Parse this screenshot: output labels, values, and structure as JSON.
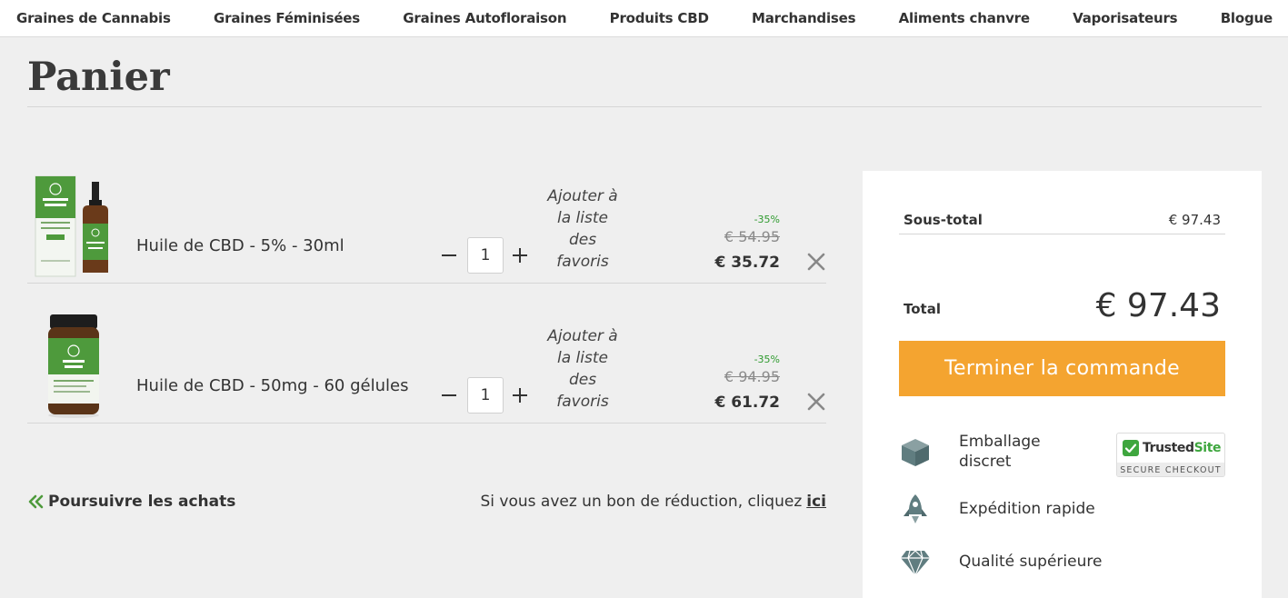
{
  "nav": {
    "items": [
      "Graines de Cannabis",
      "Graines Féminisées",
      "Graines Autofloraison",
      "Produits CBD",
      "Marchandises",
      "Aliments chanvre",
      "Vaporisateurs",
      "Blogue"
    ]
  },
  "page": {
    "title": "Panier"
  },
  "cart": {
    "items": [
      {
        "name": "Huile de CBD - 5% - 30ml",
        "quantity": "1",
        "wishlist_label": "Ajouter à la liste des favoris",
        "discount": "-35%",
        "old_price": "€ 54.95",
        "new_price": "€ 35.72",
        "image_icon": "cbd-oil-bottle-box"
      },
      {
        "name": "Huile de CBD - 50mg - 60 gélules",
        "quantity": "1",
        "wishlist_label": "Ajouter à la liste des favoris",
        "discount": "-35%",
        "old_price": "€ 94.95",
        "new_price": "€ 61.72",
        "image_icon": "cbd-capsules-jar"
      }
    ],
    "continue_label": "Poursuivre les achats",
    "coupon_text": "Si vous avez un bon de réduction, cliquez",
    "coupon_link": "ici"
  },
  "summary": {
    "subtotal_label": "Sous-total",
    "subtotal_value": "€ 97.43",
    "total_label": "Total",
    "total_value": "€ 97.43",
    "checkout_label": "Terminer la commande",
    "features": [
      {
        "icon": "box-icon",
        "label": "Emballage discret"
      },
      {
        "icon": "rocket-icon",
        "label": "Expédition rapide"
      },
      {
        "icon": "diamond-icon",
        "label": "Qualité supérieure"
      }
    ],
    "trusted": {
      "brand_main": "Trusted",
      "brand_site": "Site",
      "tagline": "SECURE CHECKOUT"
    }
  },
  "colors": {
    "accent": "#f4a430",
    "discount_green": "#2e9a2e",
    "icon_green": "#5a8a4a",
    "icon_slate": "#607d80"
  }
}
